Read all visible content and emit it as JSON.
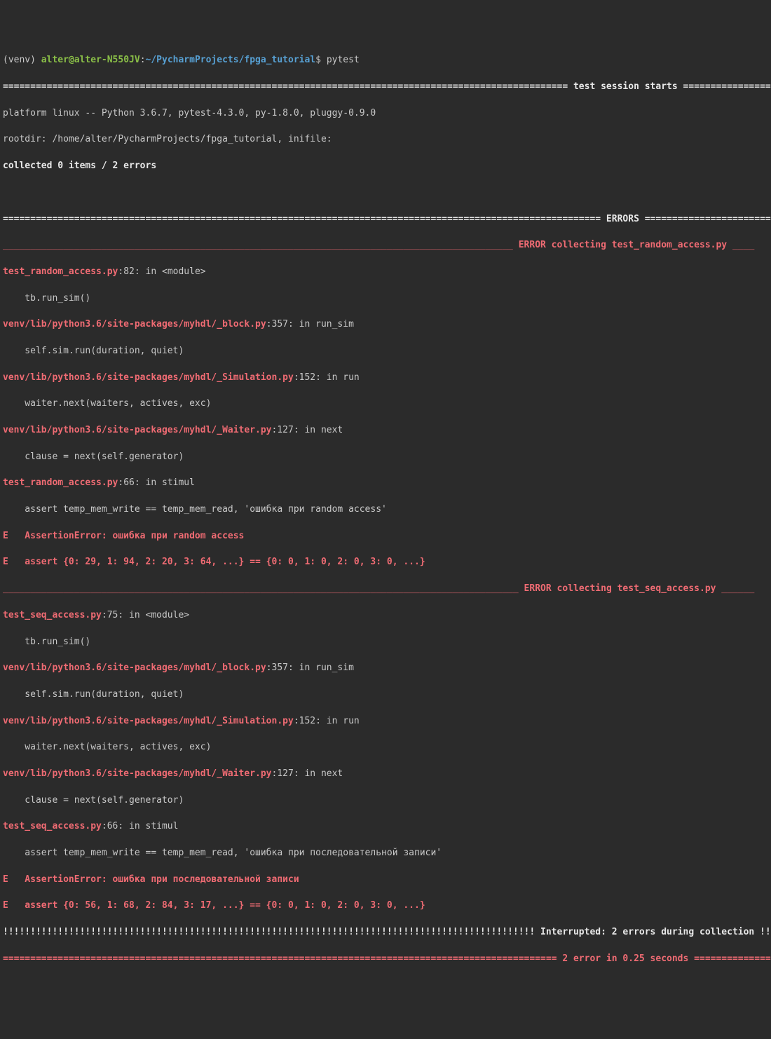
{
  "prompt": {
    "venv": "(venv) ",
    "user": "alter@alter-N550JV",
    "colon": ":",
    "path": "~/PycharmProjects/fpga_tutorial",
    "dollar": "$ ",
    "cmd": "pytest"
  },
  "session_line": "======================================================================================================= test session starts =================",
  "platform": "platform linux -- Python 3.6.7, pytest-4.3.0, py-1.8.0, pluggy-0.9.0",
  "rootdir": "rootdir: /home/alter/PycharmProjects/fpga_tutorial, inifile:",
  "collected": "collected 0 items / 2 errors",
  "errors_hdr": "============================================================================================================= ERRORS ==============================",
  "err1_hdr_pre": "_____________________________________________________________________________________________ ",
  "err1_hdr_txt": "ERROR collecting test_random_access.py",
  "err1_hdr_post": " ____",
  "r1_loc1": "test_random_access.py",
  "r1_loc1_tail": ":82: in <module>",
  "r1_code1": "    tb.run_sim()",
  "r1_loc2": "venv/lib/python3.6/site-packages/myhdl/_block.py",
  "r1_loc2_tail": ":357: in run_sim",
  "r1_code2": "    self.sim.run(duration, quiet)",
  "r1_loc3": "venv/lib/python3.6/site-packages/myhdl/_Simulation.py",
  "r1_loc3_tail": ":152: in run",
  "r1_code3": "    waiter.next(waiters, actives, exc)",
  "r1_loc4": "venv/lib/python3.6/site-packages/myhdl/_Waiter.py",
  "r1_loc4_tail": ":127: in next",
  "r1_code4": "    clause = next(self.generator)",
  "r1_loc5": "test_random_access.py",
  "r1_loc5_tail": ":66: in stimul",
  "r1_code5": "    assert temp_mem_write == temp_mem_read, 'ошибка при random access'",
  "r1_err1": "E   AssertionError: ошибка при random access",
  "r1_err2": "E   assert {0: 29, 1: 94, 2: 20, 3: 64, ...} == {0: 0, 1: 0, 2: 0, 3: 0, ...}",
  "err2_hdr_pre": "______________________________________________________________________________________________ ",
  "err2_hdr_txt": "ERROR collecting test_seq_access.py",
  "err2_hdr_post": " ______",
  "r2_loc1": "test_seq_access.py",
  "r2_loc1_tail": ":75: in <module>",
  "r2_code1": "    tb.run_sim()",
  "r2_loc2": "venv/lib/python3.6/site-packages/myhdl/_block.py",
  "r2_loc2_tail": ":357: in run_sim",
  "r2_code2": "    self.sim.run(duration, quiet)",
  "r2_loc3": "venv/lib/python3.6/site-packages/myhdl/_Simulation.py",
  "r2_loc3_tail": ":152: in run",
  "r2_code3": "    waiter.next(waiters, actives, exc)",
  "r2_loc4": "venv/lib/python3.6/site-packages/myhdl/_Waiter.py",
  "r2_loc4_tail": ":127: in next",
  "r2_code4": "    clause = next(self.generator)",
  "r2_loc5": "test_seq_access.py",
  "r2_loc5_tail": ":66: in stimul",
  "r2_code5": "    assert temp_mem_write == temp_mem_read, 'ошибка при последовательной записи'",
  "r2_err1": "E   AssertionError: ошибка при последовательной записи",
  "r2_err2": "E   assert {0: 56, 1: 68, 2: 84, 3: 17, ...} == {0: 0, 1: 0, 2: 0, 3: 0, ...}",
  "interrupt": "!!!!!!!!!!!!!!!!!!!!!!!!!!!!!!!!!!!!!!!!!!!!!!!!!!!!!!!!!!!!!!!!!!!!!!!!!!!!!!!!!!!!!!!!!!!!!!!!! Interrupted: 2 errors during collection !!!!",
  "summary": "===================================================================================================== 2 error in 0.25 seconds =================="
}
